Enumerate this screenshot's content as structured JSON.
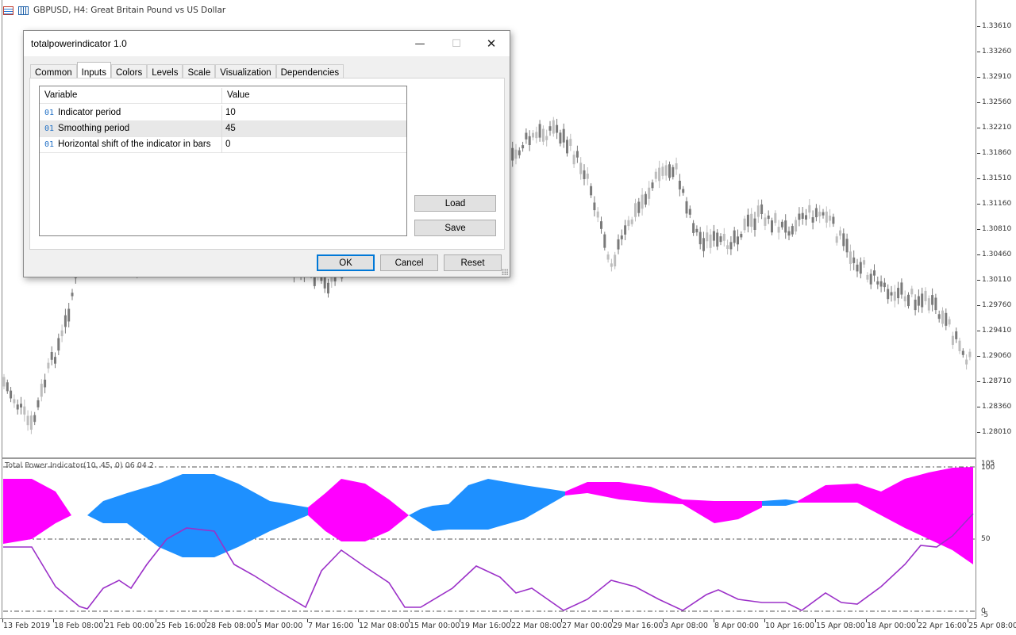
{
  "chart": {
    "symbol_title": "GBPUSD, H4:  Great Britain Pound vs US Dollar",
    "price_labels": [
      "1.33610",
      "1.33260",
      "1.32910",
      "1.32560",
      "1.32210",
      "1.31860",
      "1.31510",
      "1.31160",
      "1.30810",
      "1.30460",
      "1.30110",
      "1.29760",
      "1.29410",
      "1.29060",
      "1.28710",
      "1.28360",
      "1.28010"
    ],
    "time_labels": [
      "13 Feb 2019",
      "18 Feb 08:00",
      "21 Feb 00:00",
      "25 Feb 16:00",
      "28 Feb 08:00",
      "5 Mar 00:00",
      "7 Mar 16:00",
      "12 Mar 08:00",
      "15 Mar 00:00",
      "19 Mar 16:00",
      "22 Mar 08:00",
      "27 Mar 00:00",
      "29 Mar 16:00",
      "3 Apr 08:00",
      "8 Apr 00:00",
      "10 Apr 16:00",
      "15 Apr 08:00",
      "18 Apr 00:00",
      "22 Apr 16:00",
      "25 Apr 08:00"
    ],
    "candles_gray_color": "#7a7a7a",
    "candles_light_color": "#bdbdbd"
  },
  "indicator": {
    "title": "Total Power Indicator(10, 45, 0) 06 04 2",
    "axis_labels": {
      "top": "105",
      "max": "100",
      "mid": "50",
      "min": "0",
      "bottom": "-5"
    },
    "colors": {
      "bulls": "#ff00ff",
      "bears": "#1e90ff",
      "line": "#9b30c8"
    }
  },
  "dialog": {
    "title": "totalpowerindicator 1.0",
    "window_buttons": {
      "minimize": "—",
      "maximize": "☐",
      "close": "✕"
    },
    "tabs": [
      "Common",
      "Inputs",
      "Colors",
      "Levels",
      "Scale",
      "Visualization",
      "Dependencies"
    ],
    "active_tab": "Inputs",
    "grid_headers": {
      "variable": "Variable",
      "value": "Value"
    },
    "rows": [
      {
        "type": "01",
        "variable": "Indicator period",
        "value": "10"
      },
      {
        "type": "01",
        "variable": "Smoothing period",
        "value": "45"
      },
      {
        "type": "01",
        "variable": "Horizontal shift of the indicator in bars",
        "value": "0"
      }
    ],
    "buttons": {
      "load": "Load",
      "save": "Save",
      "ok": "OK",
      "cancel": "Cancel",
      "reset": "Reset"
    }
  }
}
